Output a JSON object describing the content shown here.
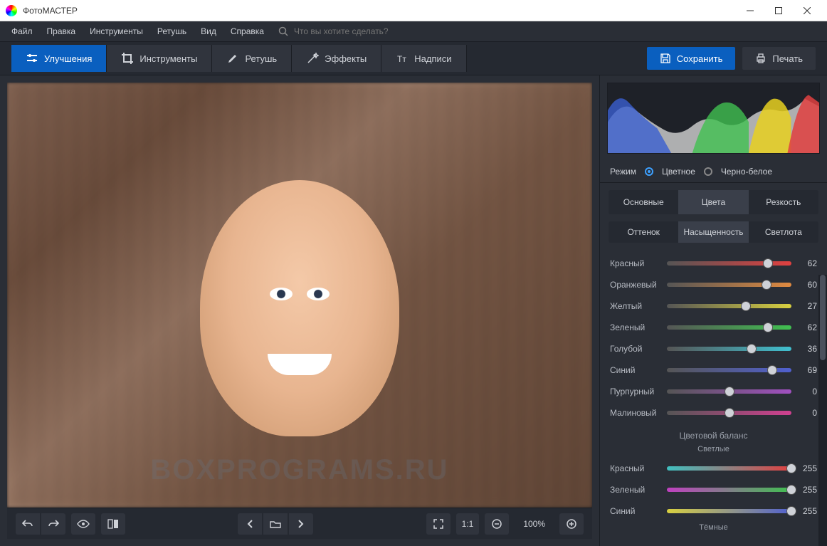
{
  "titlebar": {
    "app_name": "ФотоМАСТЕР"
  },
  "menu": {
    "items": [
      "Файл",
      "Правка",
      "Инструменты",
      "Ретушь",
      "Вид",
      "Справка"
    ],
    "search_placeholder": "Что вы хотите сделать?"
  },
  "toolbar": {
    "tabs": [
      {
        "label": "Улучшения",
        "active": true
      },
      {
        "label": "Инструменты",
        "active": false
      },
      {
        "label": "Ретушь",
        "active": false
      },
      {
        "label": "Эффекты",
        "active": false
      },
      {
        "label": "Надписи",
        "active": false
      }
    ],
    "save_label": "Сохранить",
    "print_label": "Печать"
  },
  "bottombar": {
    "ratio_label": "1:1",
    "zoom_value": "100%"
  },
  "watermark": "BOXPROGRAMS.RU",
  "panel": {
    "mode_label": "Режим",
    "mode_options": [
      "Цветное",
      "Черно-белое"
    ],
    "mode_selected": 0,
    "tabs": [
      "Основные",
      "Цвета",
      "Резкость"
    ],
    "tab_selected": 1,
    "sub_tabs": [
      "Оттенок",
      "Насыщенность",
      "Светлота"
    ],
    "sub_selected": 1,
    "color_sliders": [
      {
        "label": "Красный",
        "value": 62,
        "gradient": [
          "#555",
          "#e04040"
        ]
      },
      {
        "label": "Оранжевый",
        "value": 60,
        "gradient": [
          "#555",
          "#e08a40"
        ]
      },
      {
        "label": "Желтый",
        "value": 27,
        "gradient": [
          "#555",
          "#d8d040"
        ]
      },
      {
        "label": "Зеленый",
        "value": 62,
        "gradient": [
          "#555",
          "#40c050"
        ]
      },
      {
        "label": "Голубой",
        "value": 36,
        "gradient": [
          "#555",
          "#40c0d0"
        ]
      },
      {
        "label": "Синий",
        "value": 69,
        "gradient": [
          "#555",
          "#5060d0"
        ]
      },
      {
        "label": "Пурпурный",
        "value": 0,
        "gradient": [
          "#555",
          "#a050c0"
        ]
      },
      {
        "label": "Малиновый",
        "value": 0,
        "gradient": [
          "#555",
          "#d04090"
        ]
      }
    ],
    "balance_title": "Цветовой баланс",
    "balance_sub_light": "Светлые",
    "balance_sub_dark": "Тёмные",
    "balance_sliders": [
      {
        "label": "Красный",
        "value": 255,
        "gradient": [
          "#40c0c0",
          "#e04040"
        ]
      },
      {
        "label": "Зеленый",
        "value": 255,
        "gradient": [
          "#c040c0",
          "#40c050"
        ]
      },
      {
        "label": "Синий",
        "value": 255,
        "gradient": [
          "#d8d040",
          "#5060d0"
        ]
      }
    ]
  }
}
